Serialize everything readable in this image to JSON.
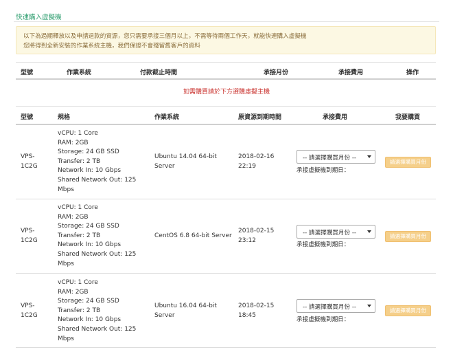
{
  "page": {
    "title": "快速購入虛擬機"
  },
  "alert": {
    "line1": "以下為過期釋放以及申請退款的資源，您只需要承接三個月以上，不需等待兩個工作天，就能快速購入虛擬機",
    "line2": "您將得到全新安裝的作業系統主機，我們保證不會殘留舊客戶的資料"
  },
  "pending_table": {
    "headers": [
      "型號",
      "作業系統",
      "付款截止時間",
      "承接月份",
      "承接費用",
      "操作"
    ],
    "empty_notice": "如需購買請於下方選購虛擬主機"
  },
  "vm_table": {
    "headers": [
      "型號",
      "規格",
      "作業系統",
      "原資源到期時間",
      "承接費用",
      "我要購買"
    ],
    "select_placeholder": "-- 請選擇購買月份 --",
    "due_label": "承接虛擬機到期日：",
    "buy_label": "請選擇購買月份",
    "rows": [
      {
        "model": [
          "VPS-",
          "1C2G"
        ],
        "spec": [
          "vCPU: 1 Core",
          "RAM: 2GB",
          "Storage: 24 GB SSD",
          "Transfer: 2 TB",
          "Network In: 10 Gbps",
          "Shared Network Out: 125",
          "Mbps"
        ],
        "os": [
          "Ubuntu 14.04 64-bit",
          "Server"
        ],
        "expire": [
          "2018-02-16",
          "22:19"
        ]
      },
      {
        "model": [
          "VPS-",
          "1C2G"
        ],
        "spec": [
          "vCPU: 1 Core",
          "RAM: 2GB",
          "Storage: 24 GB SSD",
          "Transfer: 2 TB",
          "Network In: 10 Gbps",
          "Shared Network Out: 125",
          "Mbps"
        ],
        "os": [
          "CentOS 6.8 64-bit Server"
        ],
        "expire": [
          "2018-02-15",
          "23:12"
        ]
      },
      {
        "model": [
          "VPS-",
          "1C2G"
        ],
        "spec": [
          "vCPU: 1 Core",
          "RAM: 2GB",
          "Storage: 24 GB SSD",
          "Transfer: 2 TB",
          "Network In: 10 Gbps",
          "Shared Network Out: 125",
          "Mbps"
        ],
        "os": [
          "Ubuntu 16.04 64-bit",
          "Server"
        ],
        "expire": [
          "2018-02-15",
          "18:45"
        ]
      }
    ]
  },
  "colors": {
    "title_green": "#2e9e6f",
    "alert_bg": "#fcf8e3",
    "alert_text": "#8a6d3b",
    "notice_red": "#c9302c",
    "buy_button": "#f5cf8a"
  }
}
